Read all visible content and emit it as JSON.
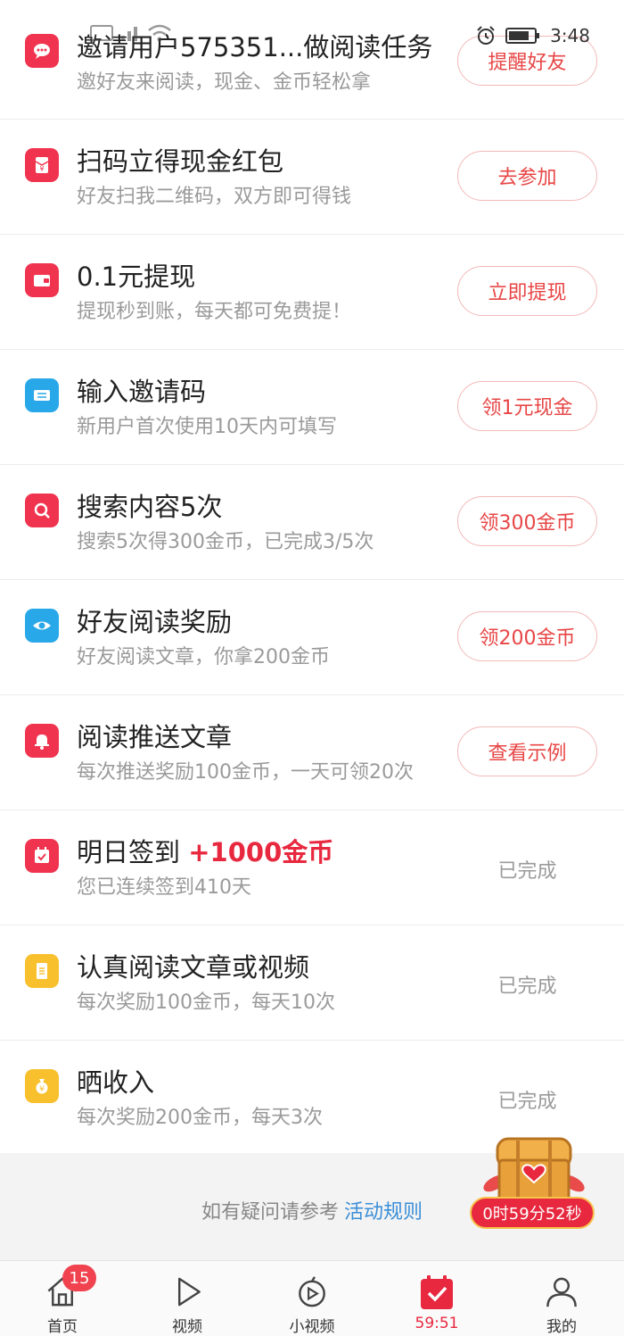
{
  "status_bar": {
    "time": "3:48"
  },
  "tasks": [
    {
      "title": "邀请用户575351...做阅读任务",
      "desc": "邀好友来阅读，现金、金币轻松拿",
      "button": "提醒好友",
      "icon": "chat-icon",
      "color": "#f0344f"
    },
    {
      "title": "扫码立得现金红包",
      "desc": "好友扫我二维码，双方即可得钱",
      "button": "去参加",
      "icon": "red-envelope-icon",
      "color": "#f0344f"
    },
    {
      "title": "0.1元提现",
      "desc": "提现秒到账，每天都可免费提！",
      "button": "立即提现",
      "icon": "wallet-icon",
      "color": "#f0344f"
    },
    {
      "title": "输入邀请码",
      "desc": "新用户首次使用10天内可填写",
      "button": "领1元现金",
      "icon": "ticket-icon",
      "color": "#28a8e8"
    },
    {
      "title": "搜索内容5次",
      "desc": "搜索5次得300金币，已完成3/5次",
      "button": "领300金币",
      "icon": "search-icon",
      "color": "#f0344f"
    },
    {
      "title": "好友阅读奖励",
      "desc": "好友阅读文章，你拿200金币",
      "button": "领200金币",
      "icon": "eye-icon",
      "color": "#28a8e8"
    },
    {
      "title": "阅读推送文章",
      "desc": "每次推送奖励100金币，一天可领20次",
      "button": "查看示例",
      "icon": "bell-icon",
      "color": "#f0344f"
    },
    {
      "title": "明日签到",
      "reward": "+1000金币",
      "desc": "您已连续签到410天",
      "status": "已完成",
      "icon": "calendar-check-icon",
      "color": "#f0344f"
    },
    {
      "title": "认真阅读文章或视频",
      "desc": "每次奖励100金币，每天10次",
      "status": "已完成",
      "icon": "document-icon",
      "color": "#f7c02c"
    },
    {
      "title": "晒收入",
      "desc": "每次奖励200金币，每天3次",
      "status": "已完成",
      "icon": "money-bag-icon",
      "color": "#f7c02c"
    }
  ],
  "footer": {
    "help_prefix": "如有疑问请参考",
    "rules_link": "活动规则"
  },
  "treasure": {
    "timer": "0时59分52秒"
  },
  "tab_bar": {
    "home_badge": "15",
    "items": [
      {
        "label": "首页",
        "icon": "home-icon"
      },
      {
        "label": "视频",
        "icon": "play-icon"
      },
      {
        "label": "小视频",
        "icon": "short-video-icon"
      },
      {
        "label": "59:51",
        "icon": "calendar-check-icon"
      },
      {
        "label": "我的",
        "icon": "profile-icon"
      }
    ]
  },
  "colors": {
    "accent": "#e8283f",
    "link": "#3a8fd8",
    "button_border": "#f3b9b9"
  }
}
